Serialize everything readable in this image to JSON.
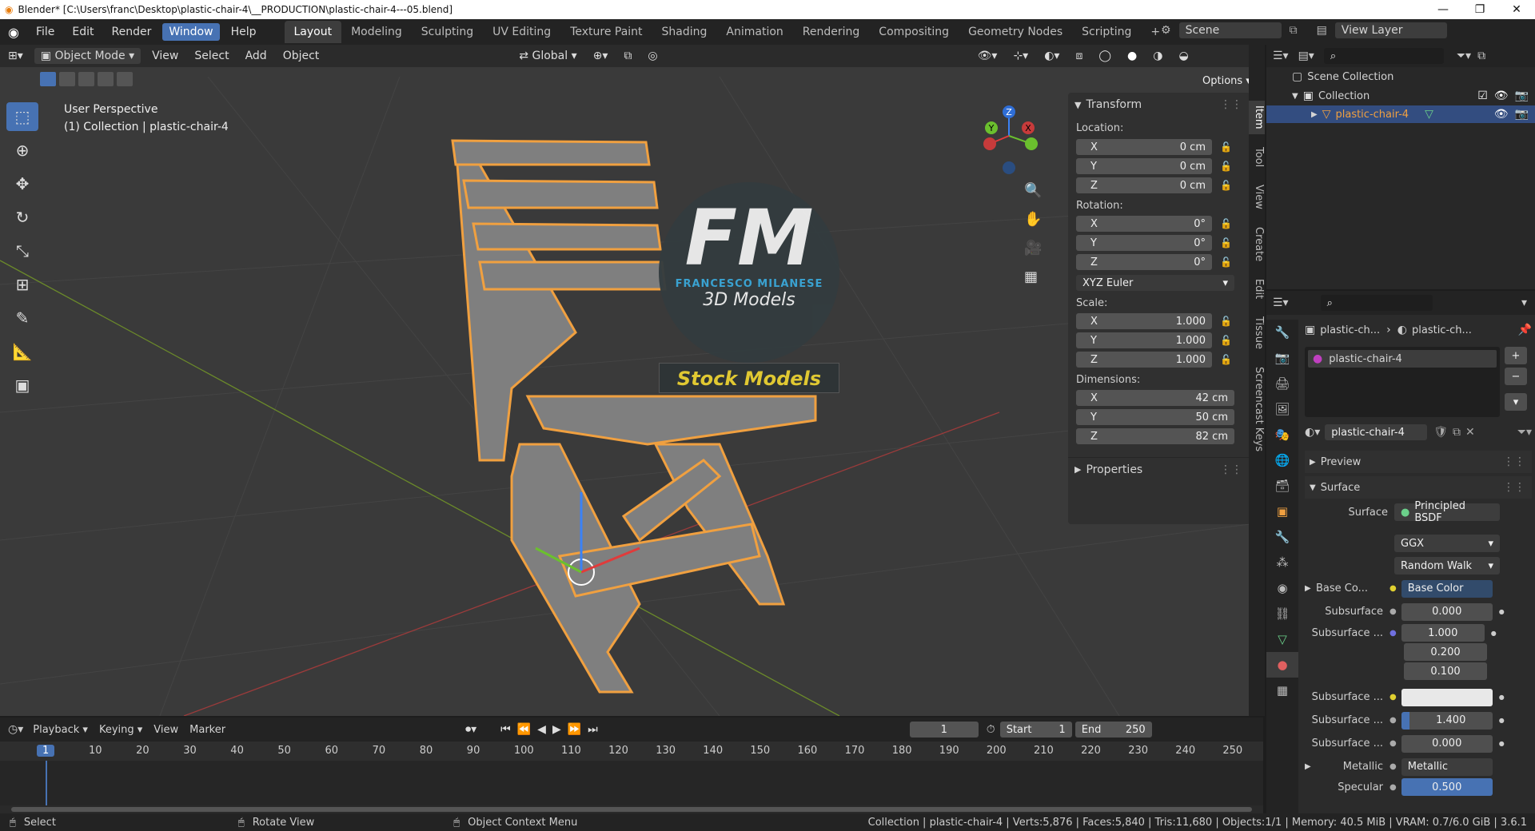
{
  "window": {
    "title": "Blender* [C:\\Users\\franc\\Desktop\\plastic-chair-4\\__PRODUCTION\\plastic-chair-4---05.blend]",
    "minimize": "—",
    "maximize": "❐",
    "close": "✕"
  },
  "menu": [
    "File",
    "Edit",
    "Render",
    "Window",
    "Help"
  ],
  "active_menu": "Window",
  "workspaces": [
    "Layout",
    "Modeling",
    "Sculpting",
    "UV Editing",
    "Texture Paint",
    "Shading",
    "Animation",
    "Rendering",
    "Compositing",
    "Geometry Nodes",
    "Scripting"
  ],
  "active_workspace": "Layout",
  "add_workspace": "+",
  "scene": {
    "label": "Scene",
    "view_layer": "View Layer"
  },
  "viewport_header": {
    "mode": "Object Mode",
    "menus": [
      "View",
      "Select",
      "Add",
      "Object"
    ],
    "transform_orientation": "Global",
    "options": "Options"
  },
  "viewport_info": {
    "line1": "User Perspective",
    "line2": "(1) Collection | plastic-chair-4"
  },
  "watermark": {
    "logo": "FM",
    "name": "FRANCESCO MILANESE",
    "sub": "3D Models",
    "badge": "Stock Models"
  },
  "gizmo": {
    "z": "Z",
    "y": "Y",
    "x": "X"
  },
  "npanel": {
    "header": "Transform",
    "location_label": "Location:",
    "location": [
      {
        "axis": "X",
        "val": "0 cm"
      },
      {
        "axis": "Y",
        "val": "0 cm"
      },
      {
        "axis": "Z",
        "val": "0 cm"
      }
    ],
    "rotation_label": "Rotation:",
    "rotation": [
      {
        "axis": "X",
        "val": "0°"
      },
      {
        "axis": "Y",
        "val": "0°"
      },
      {
        "axis": "Z",
        "val": "0°"
      }
    ],
    "rotation_mode": "XYZ Euler",
    "scale_label": "Scale:",
    "scale": [
      {
        "axis": "X",
        "val": "1.000"
      },
      {
        "axis": "Y",
        "val": "1.000"
      },
      {
        "axis": "Z",
        "val": "1.000"
      }
    ],
    "dimensions_label": "Dimensions:",
    "dimensions": [
      {
        "axis": "X",
        "val": "42 cm"
      },
      {
        "axis": "Y",
        "val": "50 cm"
      },
      {
        "axis": "Z",
        "val": "82 cm"
      }
    ],
    "properties": "Properties",
    "tabs": [
      "Item",
      "Tool",
      "View",
      "Create",
      "Edit",
      "Tissue",
      "Screencast Keys"
    ]
  },
  "outliner": {
    "scene_collection": "Scene Collection",
    "collection": "Collection",
    "object": "plastic-chair-4"
  },
  "properties": {
    "breadcrumb_obj": "plastic-ch...",
    "breadcrumb_mat": "plastic-ch...",
    "slot": "plastic-chair-4",
    "material": "plastic-chair-4",
    "preview": "Preview",
    "surface_header": "Surface",
    "surface_label": "Surface",
    "surface_val": "Principled BSDF",
    "distribution": "GGX",
    "subsurface_method": "Random Walk",
    "rows": [
      {
        "label": "Base Co...",
        "val": "Base Color"
      },
      {
        "label": "Subsurface",
        "val": "0.000"
      },
      {
        "label": "Subsurface ...",
        "val": "1.000"
      },
      {
        "label": "",
        "val": "0.200"
      },
      {
        "label": "",
        "val": "0.100"
      },
      {
        "label": "Subsurface ...",
        "val": ""
      },
      {
        "label": "Subsurface ...",
        "val": "1.400"
      },
      {
        "label": "Subsurface ...",
        "val": "0.000"
      },
      {
        "label": "Metallic",
        "val": "Metallic"
      },
      {
        "label": "Specular",
        "val": "0.500"
      }
    ]
  },
  "timeline": {
    "menus": [
      "Playback",
      "Keying",
      "View",
      "Marker"
    ],
    "current_frame": "1",
    "start_label": "Start",
    "start": "1",
    "end_label": "End",
    "end": "250",
    "ticks": [
      "1",
      "10",
      "20",
      "30",
      "40",
      "50",
      "60",
      "70",
      "80",
      "90",
      "100",
      "110",
      "120",
      "130",
      "140",
      "150",
      "160",
      "170",
      "180",
      "190",
      "200",
      "210",
      "220",
      "230",
      "240",
      "250"
    ]
  },
  "status": {
    "select": "Select",
    "rotate": "Rotate View",
    "context": "Object Context Menu",
    "stats": "Collection | plastic-chair-4 | Verts:5,876 | Faces:5,840 | Tris:11,680 | Objects:1/1 | Memory: 40.5 MiB | VRAM: 0.7/6.0 GiB | 3.6.1"
  }
}
